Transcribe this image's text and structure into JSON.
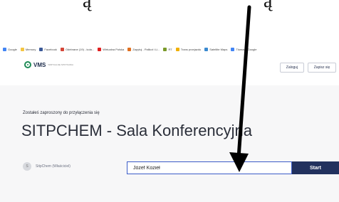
{
  "top_fragment": {
    "left_text": "ą",
    "right_text": "ą"
  },
  "bookmarks": [
    {
      "label": "Google",
      "icon": "google-icon",
      "color": "#4285f4"
    },
    {
      "label": "Memory",
      "icon": "folder-icon",
      "color": "#f4c542"
    },
    {
      "label": "Facebook",
      "icon": "facebook-icon",
      "color": "#3b5998"
    },
    {
      "label": "Odebrane (19) - kola...",
      "icon": "mail-icon",
      "color": "#d44638"
    },
    {
      "label": "Wirtualna Polska",
      "icon": "wp-icon",
      "color": "#e02020"
    },
    {
      "label": "Zapytuj - Palikot i Li...",
      "icon": "bookmark-icon",
      "color": "#e07020"
    },
    {
      "label": "RT",
      "icon": "rt-icon",
      "color": "#7a9a2a"
    },
    {
      "label": "Trans przejazdu",
      "icon": "star-icon",
      "color": "#f0b000"
    },
    {
      "label": "Satellite Maps",
      "icon": "map-icon",
      "color": "#3a8ad0"
    },
    {
      "label": "Tłumacz Google",
      "icon": "translate-icon",
      "color": "#4285f4"
    }
  ],
  "header": {
    "logo_text": "VMS",
    "logo_sub": "WIRTUALNE SPOTKANIA",
    "login_label": "Zaloguj",
    "register_label": "Zapisz się"
  },
  "main": {
    "invite_text": "Zostałeś zaproszony do przyłączenia się",
    "room_title": "SITPCHEM - Sala Konferencyjna",
    "owner_initial": "S",
    "owner_label": "SitpChem (Właściciel)",
    "name_value": "Józef Kozieł",
    "start_label": "Start"
  },
  "colors": {
    "accent": "#22315e",
    "input_border": "#3b5cc8",
    "logo_green": "#1f8b56"
  }
}
